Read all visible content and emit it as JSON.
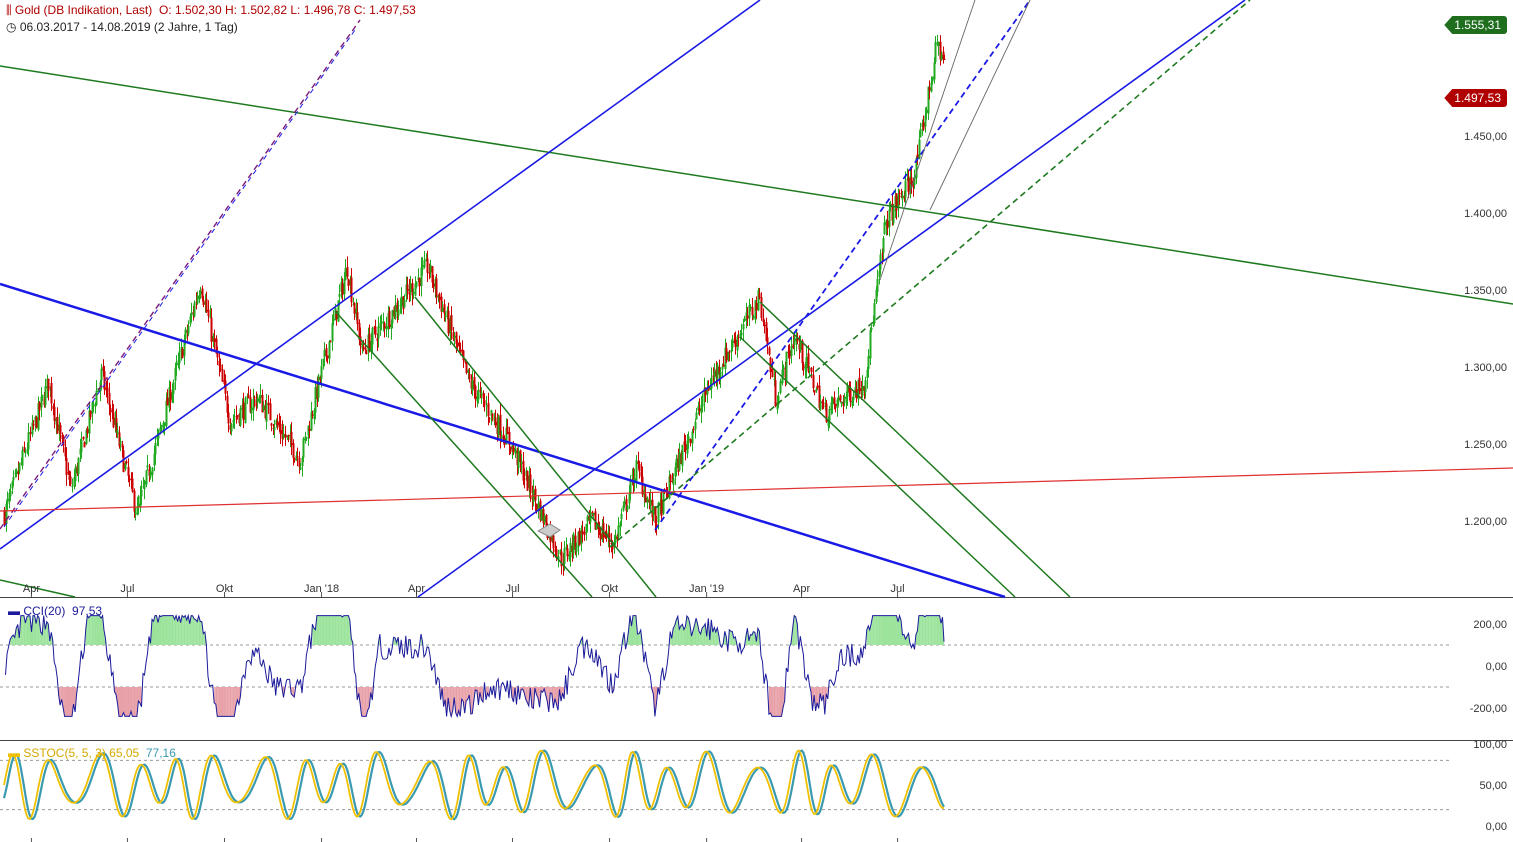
{
  "header": {
    "instrument": "Gold (DB Indikation, Last)",
    "ohlc": "O: 1.502,30  H: 1.502,82  L: 1.496,78  C: 1.497,53",
    "range": "06.03.2017 - 14.08.2019  (2 Jahre, 1 Tag)"
  },
  "price_tags": {
    "resistance": "1.555,31",
    "last": "1.497,53"
  },
  "colors": {
    "candle_up": "#22aa22",
    "candle_down": "#cc0000",
    "trend_blue": "#1a1ae6",
    "trend_green": "#1e7a1e",
    "support_red": "#e03030",
    "cci_line": "#1a1a9a",
    "stoch_k": "#f0c000",
    "stoch_d": "#3a9ab0"
  },
  "chart_data": [
    {
      "type": "candlestick",
      "title": "Gold (DB Indikation, Last)",
      "x_months": [
        "Apr",
        "Jul",
        "Okt",
        "Jan '18",
        "Apr",
        "Jul",
        "Okt",
        "Jan '19",
        "Apr",
        "Jul"
      ],
      "ylim": [
        1160,
        1570
      ],
      "y_ticks": [
        "1.200,00",
        "1.250,00",
        "1.300,00",
        "1.350,00",
        "1.400,00",
        "1.450,00"
      ],
      "y_tick_values": [
        1200,
        1250,
        1300,
        1350,
        1400,
        1450
      ],
      "approx_close_path": [
        [
          "2017-03-06",
          1205
        ],
        [
          "2017-04-17",
          1290
        ],
        [
          "2017-05-08",
          1220
        ],
        [
          "2017-06-06",
          1295
        ],
        [
          "2017-07-10",
          1205
        ],
        [
          "2017-09-08",
          1355
        ],
        [
          "2017-10-06",
          1265
        ],
        [
          "2017-11-01",
          1280
        ],
        [
          "2017-12-12",
          1240
        ],
        [
          "2018-01-25",
          1365
        ],
        [
          "2018-02-08",
          1310
        ],
        [
          "2018-04-11",
          1365
        ],
        [
          "2018-05-21",
          1290
        ],
        [
          "2018-06-29",
          1250
        ],
        [
          "2018-08-16",
          1175
        ],
        [
          "2018-09-14",
          1200
        ],
        [
          "2018-10-05",
          1185
        ],
        [
          "2018-10-26",
          1235
        ],
        [
          "2018-11-13",
          1200
        ],
        [
          "2019-01-04",
          1290
        ],
        [
          "2019-02-20",
          1345
        ],
        [
          "2019-03-07",
          1280
        ],
        [
          "2019-03-25",
          1320
        ],
        [
          "2019-04-23",
          1270
        ],
        [
          "2019-05-30",
          1290
        ],
        [
          "2019-06-20",
          1395
        ],
        [
          "2019-07-17",
          1425
        ],
        [
          "2019-08-07",
          1510
        ],
        [
          "2019-08-14",
          1497.53
        ]
      ],
      "lines": [
        {
          "kind": "horizontal",
          "value": 1555.31,
          "color": "#1e7a1e"
        }
      ]
    },
    {
      "type": "line",
      "title": "CCI(20)",
      "last_value": "97,53",
      "ylim": [
        -270,
        260
      ],
      "y_ticks": [
        "200,00",
        "0,00",
        "-200,00"
      ],
      "y_tick_values": [
        200,
        0,
        -200
      ],
      "levels": [
        100,
        -100
      ]
    },
    {
      "type": "line",
      "title": "SSTOC(5, 5, 3)",
      "last_values": [
        "65,05",
        "77,16"
      ],
      "series": [
        {
          "name": "",
          "color": "#f0c000"
        },
        {
          "name": "",
          "color": "#3a9ab0"
        }
      ],
      "ylim": [
        -2,
        104
      ],
      "y_ticks": [
        "100,00",
        "50,00",
        "0,00"
      ],
      "y_tick_values": [
        100,
        50,
        0
      ],
      "levels": [
        80,
        20
      ]
    }
  ]
}
